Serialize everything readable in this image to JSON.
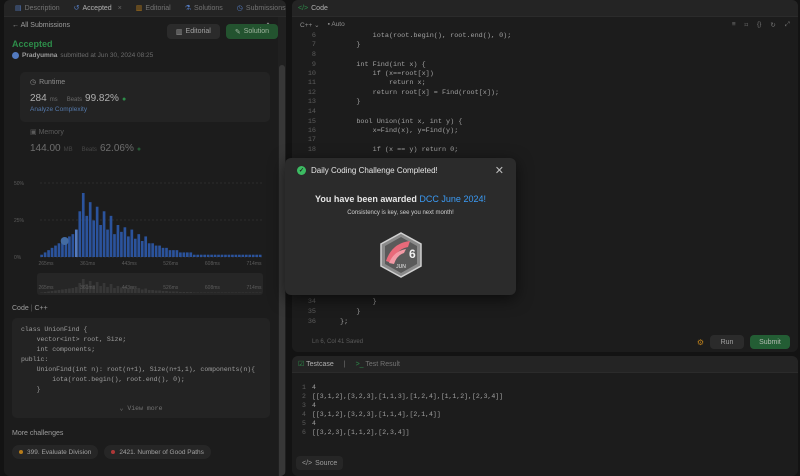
{
  "tabs": [
    {
      "label": "Description"
    },
    {
      "label": "Accepted"
    },
    {
      "label": "Editorial"
    },
    {
      "label": "Solutions"
    },
    {
      "label": "Submissions"
    }
  ],
  "left": {
    "all_submissions": "All Submissions",
    "status": "Accepted",
    "user": "Pradyumna",
    "submitted_at": "submitted at Jun 30, 2024 08:25",
    "editorial_btn": "Editorial",
    "solution_btn": "Solution",
    "runtime": {
      "label": "Runtime",
      "value": "284",
      "unit": "ms",
      "beats_label": "Beats",
      "beats": "99.82%",
      "link": "Analyze Complexity"
    },
    "memory": {
      "label": "Memory",
      "value": "144.00",
      "unit": "MB",
      "beats_label": "Beats",
      "beats": "62.06%"
    },
    "code_label": "Code",
    "code_lang": "C++",
    "code_lines": [
      "class UnionFind {",
      "    vector<int> root, Size;",
      "    int components;",
      "public:",
      "    UnionFind(int n): root(n+1), Size(n+1,1), components(n){",
      "        iota(root.begin(), root.end(), 0);",
      "    }"
    ],
    "view_more": "View more",
    "more_challenges": "More challenges",
    "chips": [
      {
        "label": "399. Evaluate Division"
      },
      {
        "label": "2421. Number of Good Paths"
      }
    ]
  },
  "chart_data": {
    "type": "bar",
    "ylabels": [
      "50%",
      "25%",
      "0%"
    ],
    "xlabels": [
      "265ms",
      "361ms",
      "443ms",
      "526ms",
      "608ms",
      "714ms"
    ],
    "values": [
      1,
      2,
      3,
      4,
      5,
      6,
      7,
      8,
      9,
      10,
      12,
      20,
      28,
      18,
      24,
      16,
      22,
      14,
      20,
      12,
      18,
      10,
      14,
      11,
      13,
      9,
      12,
      8,
      10,
      7,
      9,
      6,
      6,
      5,
      5,
      4,
      4,
      3,
      3,
      3,
      2,
      2,
      2,
      2,
      1,
      1,
      1,
      1,
      1,
      1,
      1,
      1,
      1,
      1,
      1,
      1,
      1,
      1,
      1,
      1,
      1,
      1,
      1,
      1
    ],
    "highlight_index": 10
  },
  "code_panel": {
    "title": "Code",
    "lang": "C++",
    "mode": "Auto",
    "line_numbers": [
      "6",
      "7",
      "8",
      "9",
      "10",
      "11",
      "12",
      "13",
      "14",
      "15",
      "16",
      "17",
      "18",
      "34",
      "35",
      "36"
    ],
    "lines": [
      "        iota(root.begin(), root.end(), 0);",
      "    }",
      "",
      "    int Find(int x) {",
      "        if (x==root[x])",
      "            return x;",
      "        return root[x] = Find(root[x]);",
      "    }",
      "",
      "    bool Union(int x, int y) {",
      "        x=Find(x), y=Find(y);",
      "",
      "        if (x == y) return 0;",
      "        }",
      "    }",
      "};"
    ],
    "status": "Ln 6, Col 41  Saved",
    "run": "Run",
    "submit": "Submit"
  },
  "testcase": {
    "tab1": "Testcase",
    "tab2": "Test Result",
    "lines": [
      "4",
      "[[3,1,2],[3,2,3],[1,1,3],[1,2,4],[1,1,2],[2,3,4]]",
      "4",
      "[[3,1,2],[3,2,3],[1,1,4],[2,1,4]]",
      "4",
      "[[3,2,3],[1,1,2],[2,3,4]]"
    ],
    "source_btn": "Source"
  },
  "modal": {
    "title": "Daily Coding Challenge Completed!",
    "award_prefix": "You have been awarded",
    "award": "DCC June 2024!",
    "subtitle": "Consistency is key, see you next month!",
    "badge_num": "6",
    "badge_month": "JUN"
  },
  "colors": {
    "accent_green": "#3cbb62",
    "accent_blue": "#3b9bf5"
  }
}
